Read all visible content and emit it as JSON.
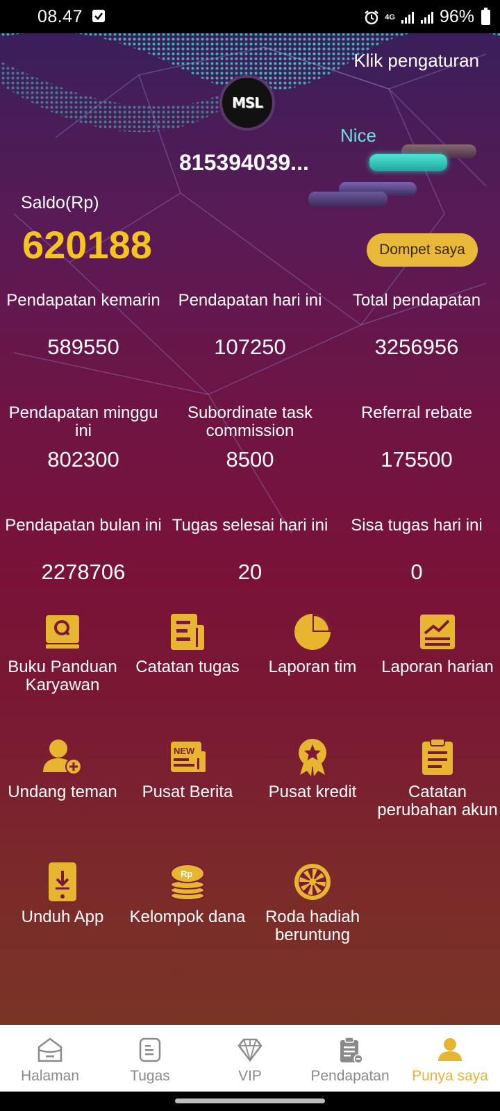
{
  "status_bar": {
    "time": "08.47",
    "network": "4G",
    "battery": "96%"
  },
  "header": {
    "settings_link": "Klik pengaturan",
    "avatar_text": "MSL",
    "user_id": "815394039...",
    "badge_label": "Nice"
  },
  "balance": {
    "label": "Saldo(Rp)",
    "value": "620188",
    "wallet_button": "Dompet saya"
  },
  "stats": [
    {
      "label": "Pendapatan kemarin",
      "value": "589550"
    },
    {
      "label": "Pendapatan hari ini",
      "value": "107250"
    },
    {
      "label": "Total pendapatan",
      "value": "3256956"
    },
    {
      "label": "Pendapatan minggu ini",
      "value": "802300"
    },
    {
      "label": "Subordinate task commission",
      "value": "8500"
    },
    {
      "label": "Referral rebate",
      "value": "175500"
    },
    {
      "label": "Pendapatan bulan ini",
      "value": "2278706"
    },
    {
      "label": "Tugas selesai hari ini",
      "value": "20"
    },
    {
      "label": "Sisa tugas hari ini",
      "value": "0"
    }
  ],
  "menu": [
    {
      "label": "Buku Panduan Karyawan",
      "icon": "handbook-icon"
    },
    {
      "label": "Catatan tugas",
      "icon": "task-record-icon"
    },
    {
      "label": "Laporan tim",
      "icon": "pie-chart-icon"
    },
    {
      "label": "Laporan harian",
      "icon": "trend-report-icon"
    },
    {
      "label": "Undang teman",
      "icon": "add-user-icon"
    },
    {
      "label": "Pusat Berita",
      "icon": "news-icon"
    },
    {
      "label": "Pusat kredit",
      "icon": "credit-badge-icon"
    },
    {
      "label": "Catatan perubahan akun",
      "icon": "clipboard-icon"
    },
    {
      "label": "Unduh App",
      "icon": "download-phone-icon"
    },
    {
      "label": "Kelompok dana",
      "icon": "coin-stack-icon"
    },
    {
      "label": "Roda hadiah beruntung",
      "icon": "lucky-wheel-icon"
    }
  ],
  "menu_icon_values": {
    "news_tag": "NEW",
    "coin_tag": "Rp"
  },
  "bottom_nav": [
    {
      "label": "Halaman",
      "icon": "home-icon"
    },
    {
      "label": "Tugas",
      "icon": "tasks-icon"
    },
    {
      "label": "VIP",
      "icon": "diamond-icon"
    },
    {
      "label": "Pendapatan",
      "icon": "earnings-icon"
    },
    {
      "label": "Punya saya",
      "icon": "profile-icon",
      "active": true
    }
  ],
  "colors": {
    "accent": "#e8b530",
    "balance": "#f4c51d",
    "badge": "#6fe0e0"
  }
}
